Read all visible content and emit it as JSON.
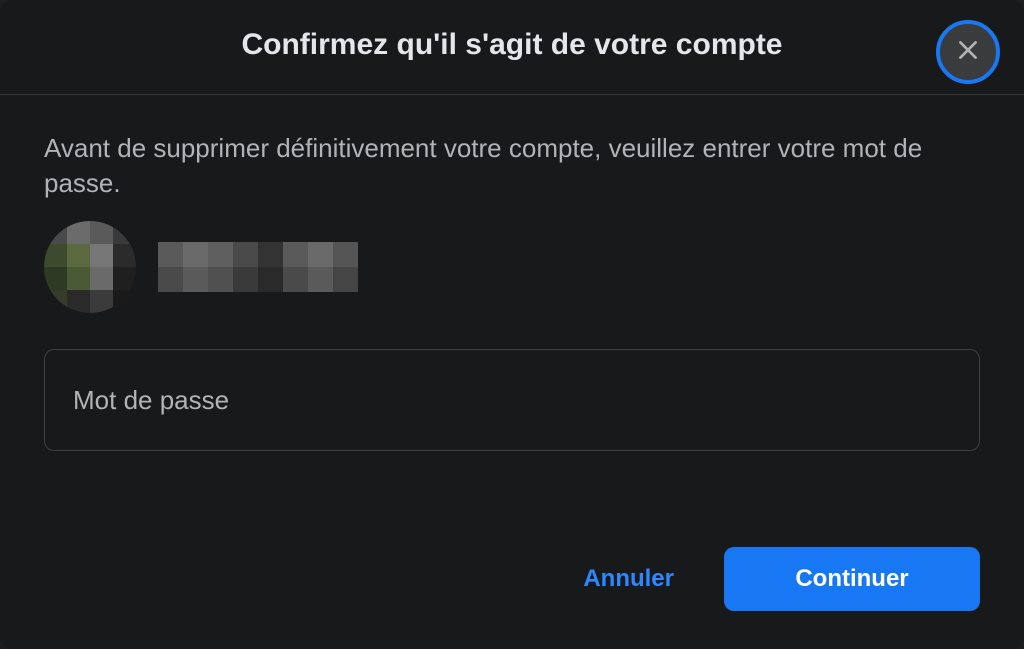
{
  "dialog": {
    "title": "Confirmez qu'il s'agit de votre compte",
    "instruction": "Avant de supprimer définitivement votre compte, veuillez entrer votre mot de passe.",
    "password_placeholder": "Mot de passe",
    "cancel_label": "Annuler",
    "continue_label": "Continuer"
  },
  "colors": {
    "accent": "#1877f2",
    "background": "#18191a",
    "text_primary": "#e4e6eb",
    "text_secondary": "#b0b3b8",
    "border": "#3e4042",
    "button_bg": "#3a3b3c"
  }
}
